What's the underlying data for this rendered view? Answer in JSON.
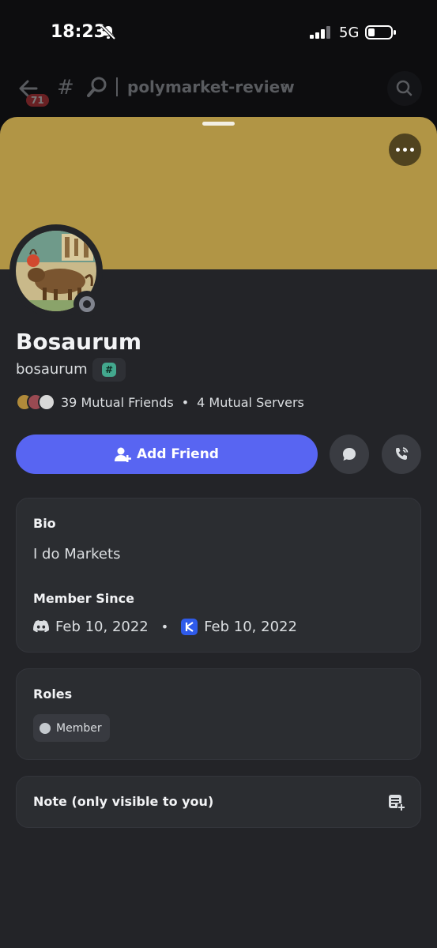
{
  "status_bar": {
    "time": "18:23",
    "network": "5G"
  },
  "header": {
    "unread_count": "71",
    "channel_name": "polymarket-review"
  },
  "profile": {
    "display_name": "Bosaurum",
    "username": "bosaurum",
    "badge_symbol": "#",
    "mutual_friends": "39 Mutual Friends",
    "mutual_servers": "4 Mutual Servers",
    "separator": "•",
    "banner_color": "#b19545",
    "status": "offline"
  },
  "actions": {
    "add_friend_label": "Add Friend"
  },
  "about": {
    "bio_heading": "Bio",
    "bio_text": "I do Markets",
    "member_since_heading": "Member Since",
    "discord_since": "Feb 10, 2022",
    "server_since": "Feb 10, 2022"
  },
  "roles": {
    "heading": "Roles",
    "items": [
      {
        "label": "Member",
        "color": "#c4c9ce"
      }
    ]
  },
  "note": {
    "label": "Note (only visible to you)"
  },
  "colors": {
    "accent": "#5865f2",
    "background": "#232428",
    "card": "#2b2d31"
  }
}
